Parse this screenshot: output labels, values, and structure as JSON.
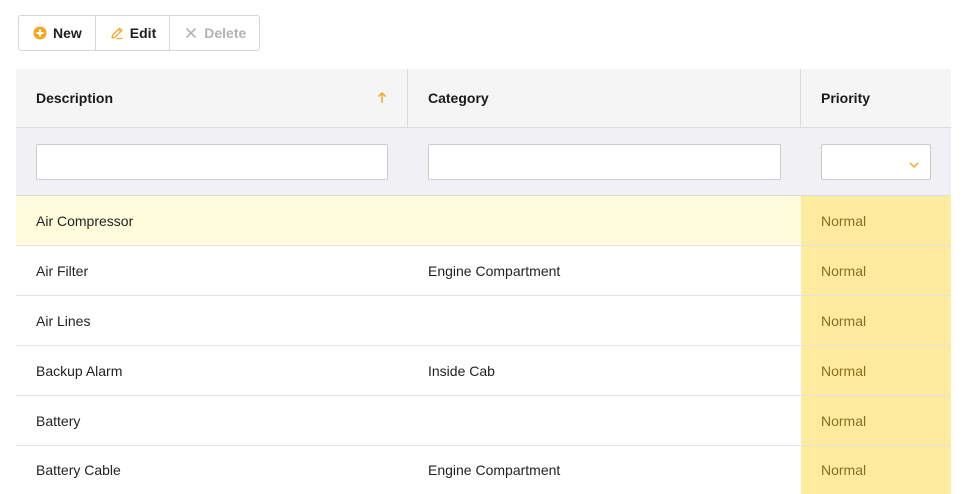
{
  "toolbar": {
    "new_label": "New",
    "edit_label": "Edit",
    "delete_label": "Delete",
    "new_icon": "plus-circle-icon",
    "edit_icon": "pencil-icon",
    "delete_icon": "x-icon"
  },
  "grid": {
    "columns": {
      "description": "Description",
      "category": "Category",
      "priority": "Priority"
    },
    "sort": {
      "column": "Description",
      "direction": "ascending"
    },
    "filters": {
      "description": "",
      "category": "",
      "priority": ""
    },
    "rows": [
      {
        "description": "Air Compressor",
        "category": "",
        "priority": "Normal",
        "selected": true
      },
      {
        "description": "Air Filter",
        "category": "Engine Compartment",
        "priority": "Normal"
      },
      {
        "description": "Air Lines",
        "category": "",
        "priority": "Normal"
      },
      {
        "description": "Backup Alarm",
        "category": "Inside Cab",
        "priority": "Normal"
      },
      {
        "description": "Battery",
        "category": "",
        "priority": "Normal"
      },
      {
        "description": "Battery Cable",
        "category": "Engine Compartment",
        "priority": "Normal"
      }
    ]
  },
  "colors": {
    "accent": "#f5a623",
    "selected_row": "#fffcdc",
    "priority_cell": "#feeb9d",
    "priority_text": "#8a6d1f"
  }
}
